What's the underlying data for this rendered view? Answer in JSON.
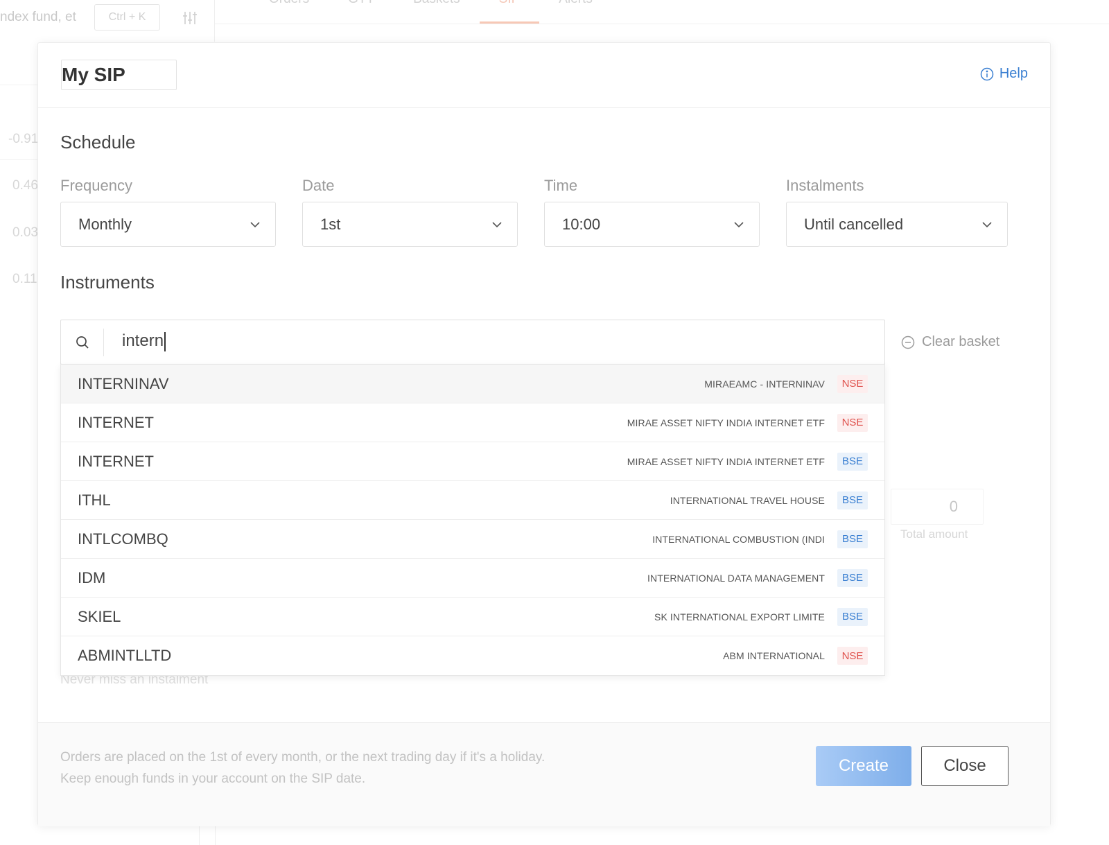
{
  "background": {
    "search_placeholder": "ndex fund, et",
    "shortcut": "Ctrl + K",
    "tabs": [
      {
        "label": "Orders",
        "active": false
      },
      {
        "label": "GTT",
        "active": false
      },
      {
        "label": "Baskets",
        "active": false
      },
      {
        "label": "SIP",
        "active": true
      },
      {
        "label": "Alerts",
        "active": false
      }
    ],
    "numbers": [
      "-0.91",
      "0.46",
      "0.03",
      "0.11"
    ]
  },
  "modal": {
    "sip_name": "My SIP",
    "help_label": "Help",
    "schedule_title": "Schedule",
    "fields": {
      "frequency": {
        "label": "Frequency",
        "value": "Monthly"
      },
      "date": {
        "label": "Date",
        "value": "1st"
      },
      "time": {
        "label": "Time",
        "value": "10:00"
      },
      "instalments": {
        "label": "Instalments",
        "value": "Until cancelled"
      }
    },
    "instruments_title": "Instruments",
    "search": {
      "value": "intern"
    },
    "clear_basket_label": "Clear basket",
    "total_amount": {
      "value": "0",
      "label": "Total amount"
    },
    "ghost_note": "Never miss an instalment",
    "dropdown": [
      {
        "symbol": "INTERNINAV",
        "name": "MIRAEAMC - INTERNINAV",
        "exchange": "NSE"
      },
      {
        "symbol": "INTERNET",
        "name": "MIRAE ASSET NIFTY INDIA INTERNET ETF",
        "exchange": "NSE"
      },
      {
        "symbol": "INTERNET",
        "name": "MIRAE ASSET NIFTY INDIA INTERNET ETF",
        "exchange": "BSE"
      },
      {
        "symbol": "ITHL",
        "name": "INTERNATIONAL TRAVEL HOUSE",
        "exchange": "BSE"
      },
      {
        "symbol": "INTLCOMBQ",
        "name": "INTERNATIONAL COMBUSTION (INDI",
        "exchange": "BSE"
      },
      {
        "symbol": "IDM",
        "name": "INTERNATIONAL DATA MANAGEMENT",
        "exchange": "BSE"
      },
      {
        "symbol": "SKIEL",
        "name": "SK INTERNATIONAL EXPORT LIMITE",
        "exchange": "BSE"
      },
      {
        "symbol": "ABMINTLLTD",
        "name": "ABM INTERNATIONAL",
        "exchange": "NSE"
      }
    ],
    "footer": {
      "note_line1": "Orders are placed on the 1st of every month, or the next trading day if it's a holiday.",
      "note_line2": "Keep enough funds in your account on the SIP date.",
      "create_label": "Create",
      "close_label": "Close"
    }
  },
  "colors": {
    "accent_blue": "#387ed1",
    "nse_red": "#df514c",
    "create_button": "#8fbdf2"
  }
}
